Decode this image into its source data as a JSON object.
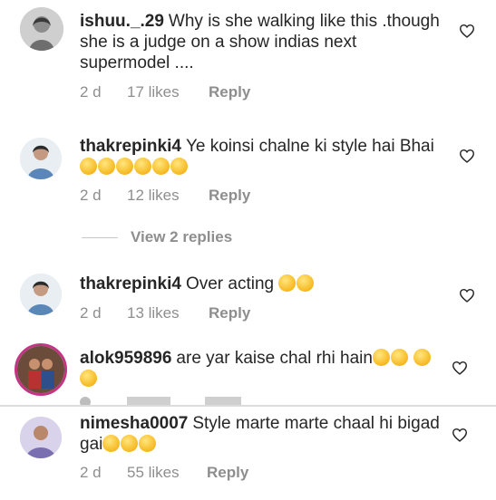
{
  "comments": [
    {
      "username": "ishuu._.29",
      "text": "Why is she walking like this .though she is a judge on a show indias next supermodel ....",
      "time": "2 d",
      "likes": "17 likes",
      "reply": "Reply",
      "emojis": []
    },
    {
      "username": "thakrepinki4",
      "text": "Ye koinsi chalne ki style hai Bhai",
      "time": "2 d",
      "likes": "12 likes",
      "reply": "Reply",
      "emojis": [
        "thinking-face",
        "thinking-face",
        "thinking-face",
        "thinking-face",
        "thinking-face",
        "thinking-face"
      ]
    },
    {
      "username": "thakrepinki4",
      "text": "Over acting",
      "time": "2 d",
      "likes": "13 likes",
      "reply": "Reply",
      "emojis": [
        "clapping-hands",
        "grinning-squinting-face"
      ]
    },
    {
      "username": "alok959896",
      "text": "are yar kaise chal rhi hain",
      "time": "",
      "likes": "",
      "reply": "",
      "emojis": [
        "grinning-squinting-face",
        "grinning-squinting-face",
        "grinning-squinting-face",
        "grinning-squinting-face"
      ]
    },
    {
      "username": "nimesha0007",
      "text": "Style marte marte chaal hi bigad gai",
      "time": "2 d",
      "likes": "55 likes",
      "reply": "Reply",
      "emojis": [
        "grinning-squinting-face",
        "grinning-squinting-face",
        "grinning-squinting-face"
      ]
    }
  ],
  "view_replies": "View 2 replies",
  "icons": {
    "like": "heart-outline-icon"
  },
  "colors": {
    "username": "#262626",
    "meta": "#8e8e8e",
    "story_ring": "#c13584",
    "divider": "#dcdcdc"
  }
}
